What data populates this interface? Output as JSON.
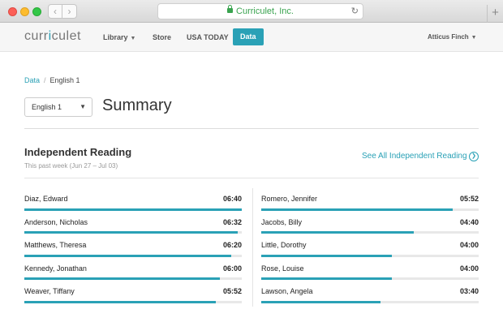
{
  "browser": {
    "url_text": "Curriculet, Inc.",
    "back_glyph": "‹",
    "forward_glyph": "›",
    "reload_glyph": "↻",
    "newtab_glyph": "+"
  },
  "app": {
    "logo_left": "curr",
    "logo_accent": "i",
    "logo_right": "culet",
    "nav": {
      "library": "Library",
      "store": "Store",
      "usa_today": "USA TODAY",
      "data": "Data"
    },
    "user_name": "Atticus Finch"
  },
  "breadcrumb": {
    "root": "Data",
    "separator": "/",
    "current": "English 1"
  },
  "class_select": {
    "value": "English 1"
  },
  "page_title": "Summary",
  "section": {
    "title": "Independent Reading",
    "subtitle": "This past week (Jun 27 – Jul 03)",
    "see_all": "See All Independent Reading"
  },
  "students_left": [
    {
      "name": "Diaz, Edward",
      "time": "06:40",
      "progress": 1.0
    },
    {
      "name": "Anderson, Nicholas",
      "time": "06:32",
      "progress": 0.98
    },
    {
      "name": "Matthews, Theresa",
      "time": "06:20",
      "progress": 0.95
    },
    {
      "name": "Kennedy, Jonathan",
      "time": "06:00",
      "progress": 0.9
    },
    {
      "name": "Weaver, Tiffany",
      "time": "05:52",
      "progress": 0.88
    }
  ],
  "students_right": [
    {
      "name": "Romero, Jennifer",
      "time": "05:52",
      "progress": 0.88
    },
    {
      "name": "Jacobs, Billy",
      "time": "04:40",
      "progress": 0.7
    },
    {
      "name": "Little, Dorothy",
      "time": "04:00",
      "progress": 0.6
    },
    {
      "name": "Rose, Louise",
      "time": "04:00",
      "progress": 0.6
    },
    {
      "name": "Lawson, Angela",
      "time": "03:40",
      "progress": 0.55
    }
  ],
  "colors": {
    "accent": "#2aa1b6",
    "track": "#e8e8e8"
  }
}
